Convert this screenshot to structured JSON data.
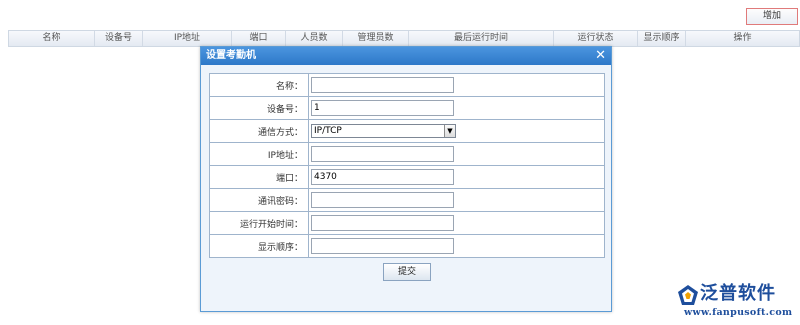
{
  "toolbar": {
    "add_label": "增加"
  },
  "grid": {
    "columns": [
      "名称",
      "设备号",
      "IP地址",
      "端口",
      "人员数",
      "管理员数",
      "最后运行时间",
      "运行状态",
      "显示顺序",
      "操作"
    ]
  },
  "dialog": {
    "title": "设置考勤机",
    "close_glyph": "✕",
    "fields": [
      {
        "label": "名称：",
        "value": ""
      },
      {
        "label": "设备号：",
        "value": "1"
      },
      {
        "label": "通信方式：",
        "value": "IP/TCP"
      },
      {
        "label": "IP地址：",
        "value": ""
      },
      {
        "label": "端口：",
        "value": "4370"
      },
      {
        "label": "通讯密码：",
        "value": ""
      },
      {
        "label": "运行开始时间：",
        "value": ""
      },
      {
        "label": "显示顺序：",
        "value": ""
      }
    ],
    "submit_label": "提交"
  },
  "logo": {
    "name": "泛普软件",
    "url": "www.fanpusoft.com",
    "colors": {
      "brand": "#1e4e9c",
      "accent": "#f0a000"
    }
  }
}
